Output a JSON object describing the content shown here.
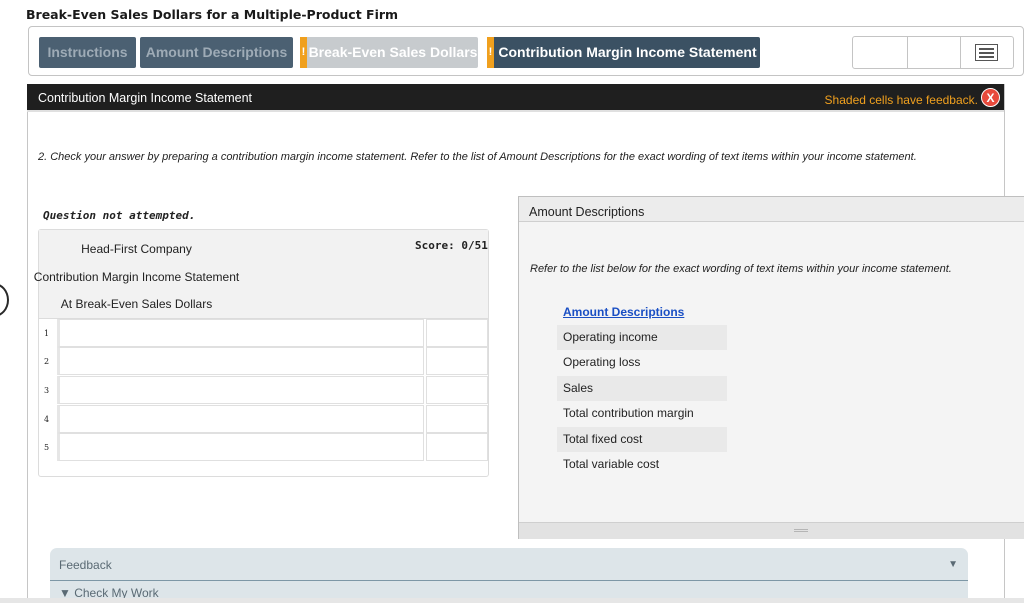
{
  "page": {
    "title": "Break-Even Sales Dollars for a Multiple-Product Firm"
  },
  "tabs": [
    {
      "label": "Instructions",
      "flagged": false
    },
    {
      "label": "Amount Descriptions",
      "flagged": false
    },
    {
      "label": "Break-Even Sales Dollars",
      "flagged": true,
      "flag": "!"
    },
    {
      "label": "Contribution Margin Income Statement",
      "flagged": true,
      "flag": "!"
    }
  ],
  "panel": {
    "title": "Contribution Margin Income Statement",
    "shaded_note": "Shaded cells have feedback.",
    "close_label": "X"
  },
  "instruction": "2. Check your answer by preparing a contribution margin income statement. Refer to the list of Amount Descriptions for the exact wording of text items within your income statement.",
  "status": "Question not attempted.",
  "statement": {
    "company": "Head-First Company",
    "title": "Contribution Margin Income Statement",
    "subtitle": "At Break-Even Sales Dollars",
    "score": "Score: 0/51",
    "row_numbers": [
      "1",
      "2",
      "3",
      "4",
      "5"
    ]
  },
  "amount_panel": {
    "title": "Amount Descriptions",
    "note": "Refer to the list below for the exact wording of text items within your income statement.",
    "heading": "Amount Descriptions",
    "items": [
      "Operating income",
      "Operating loss",
      "Sales",
      "Total contribution margin",
      "Total fixed cost",
      "Total variable cost"
    ]
  },
  "feedback": {
    "title": "Feedback",
    "check_work": "▼ Check My Work"
  },
  "icons": {
    "menu": "menu-icon",
    "close": "close-icon",
    "collapse": "chevron-down-icon"
  },
  "colors": {
    "tab_active": "#3b5163",
    "tab_inactive": "#4b6072",
    "flag": "#f0a01e",
    "close": "#e84a3c",
    "link": "#1a4fc4"
  }
}
